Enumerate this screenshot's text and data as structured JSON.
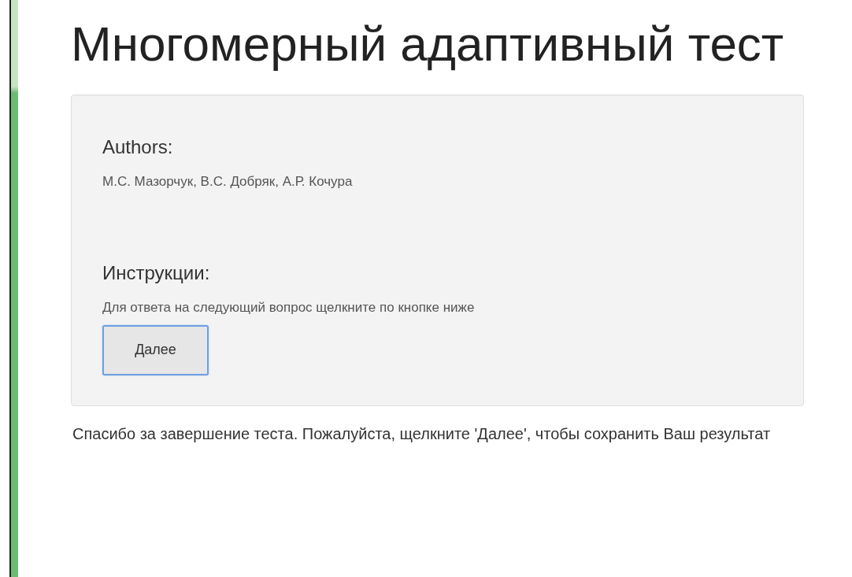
{
  "page": {
    "title": "Многомерный адаптивный тест"
  },
  "panel": {
    "authors_heading": "Authors:",
    "authors": "М.С. Мазорчук, В.С. Добряк, А.Р. Кочура",
    "instructions_heading": "Инструкции:",
    "instructions": "Для ответа на следующий вопрос щелкните по кнопке ниже",
    "button": {
      "label": "Далее",
      "focused": true
    }
  },
  "footer_note": "Спасибо за завершение теста. Пожалуйста, щелкните 'Далее', чтобы сохранить Ваш результат"
}
